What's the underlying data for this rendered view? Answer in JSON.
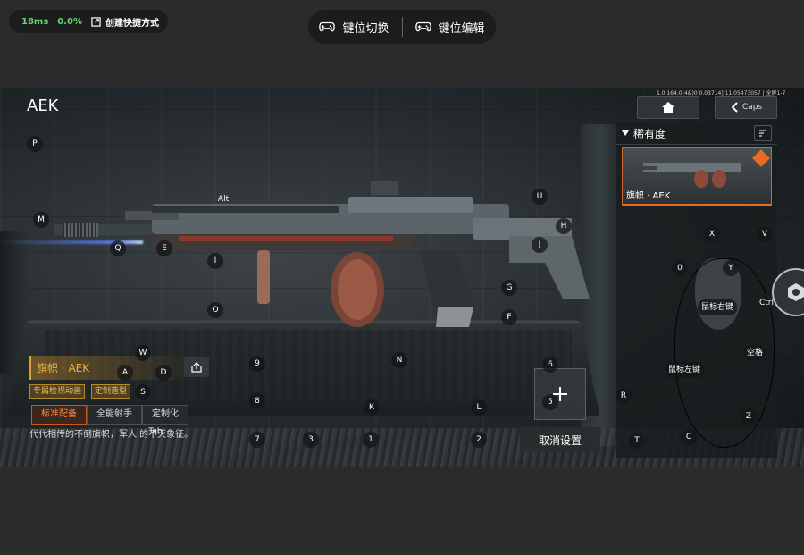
{
  "overlay": {
    "latency": "18ms",
    "loss": "0.0%",
    "shortcut_label": "创建快捷方式",
    "mode_switch_label": "键位切换",
    "mode_edit_label": "键位编辑"
  },
  "game": {
    "weapon_title": "AEK",
    "sys_info": "1.0.164.0(4&)0 0.03714] 11.05473057 | 全屏1-7",
    "caps_label": "Caps",
    "rarity_label": "稀有度",
    "skin_card_label": "旗帜 · AEK",
    "info_name": "旗帜 · AEK",
    "tags": [
      "专属检视动画",
      "定制造型"
    ],
    "tabs": [
      "标准配备",
      "全能射手",
      "定制化"
    ],
    "description": "代代相传的不倒旗帜，军人 的不灭象征。",
    "cancel_label": "取消设置",
    "keys": {
      "P": "P",
      "M": "M",
      "Q": "Q",
      "E": "E",
      "I": "I",
      "O": "O",
      "Alt": "Alt",
      "U": "U",
      "H": "H",
      "J": "J",
      "G": "G",
      "F": "F",
      "W": "W",
      "A": "A",
      "D": "D",
      "S": "S",
      "k9": "9",
      "N": "N",
      "k6": "6",
      "k8": "8",
      "K": "K",
      "L": "L",
      "k5": "5",
      "k7": "7",
      "k3": "3",
      "k1": "1",
      "k2": "2",
      "Tab": "Tab",
      "X": "X",
      "V": "V",
      "k0": "0",
      "Y": "Y",
      "R": "R",
      "Z": "Z",
      "T": "T",
      "C": "C",
      "Ctrl": "Ctrl",
      "right_click": "鼠标右键",
      "left_click": "鼠标左键",
      "space": "空格"
    }
  },
  "colors": {
    "accent_orange": "#e86a23",
    "gold": "#f0b040",
    "status_green": "#6ad36a"
  }
}
